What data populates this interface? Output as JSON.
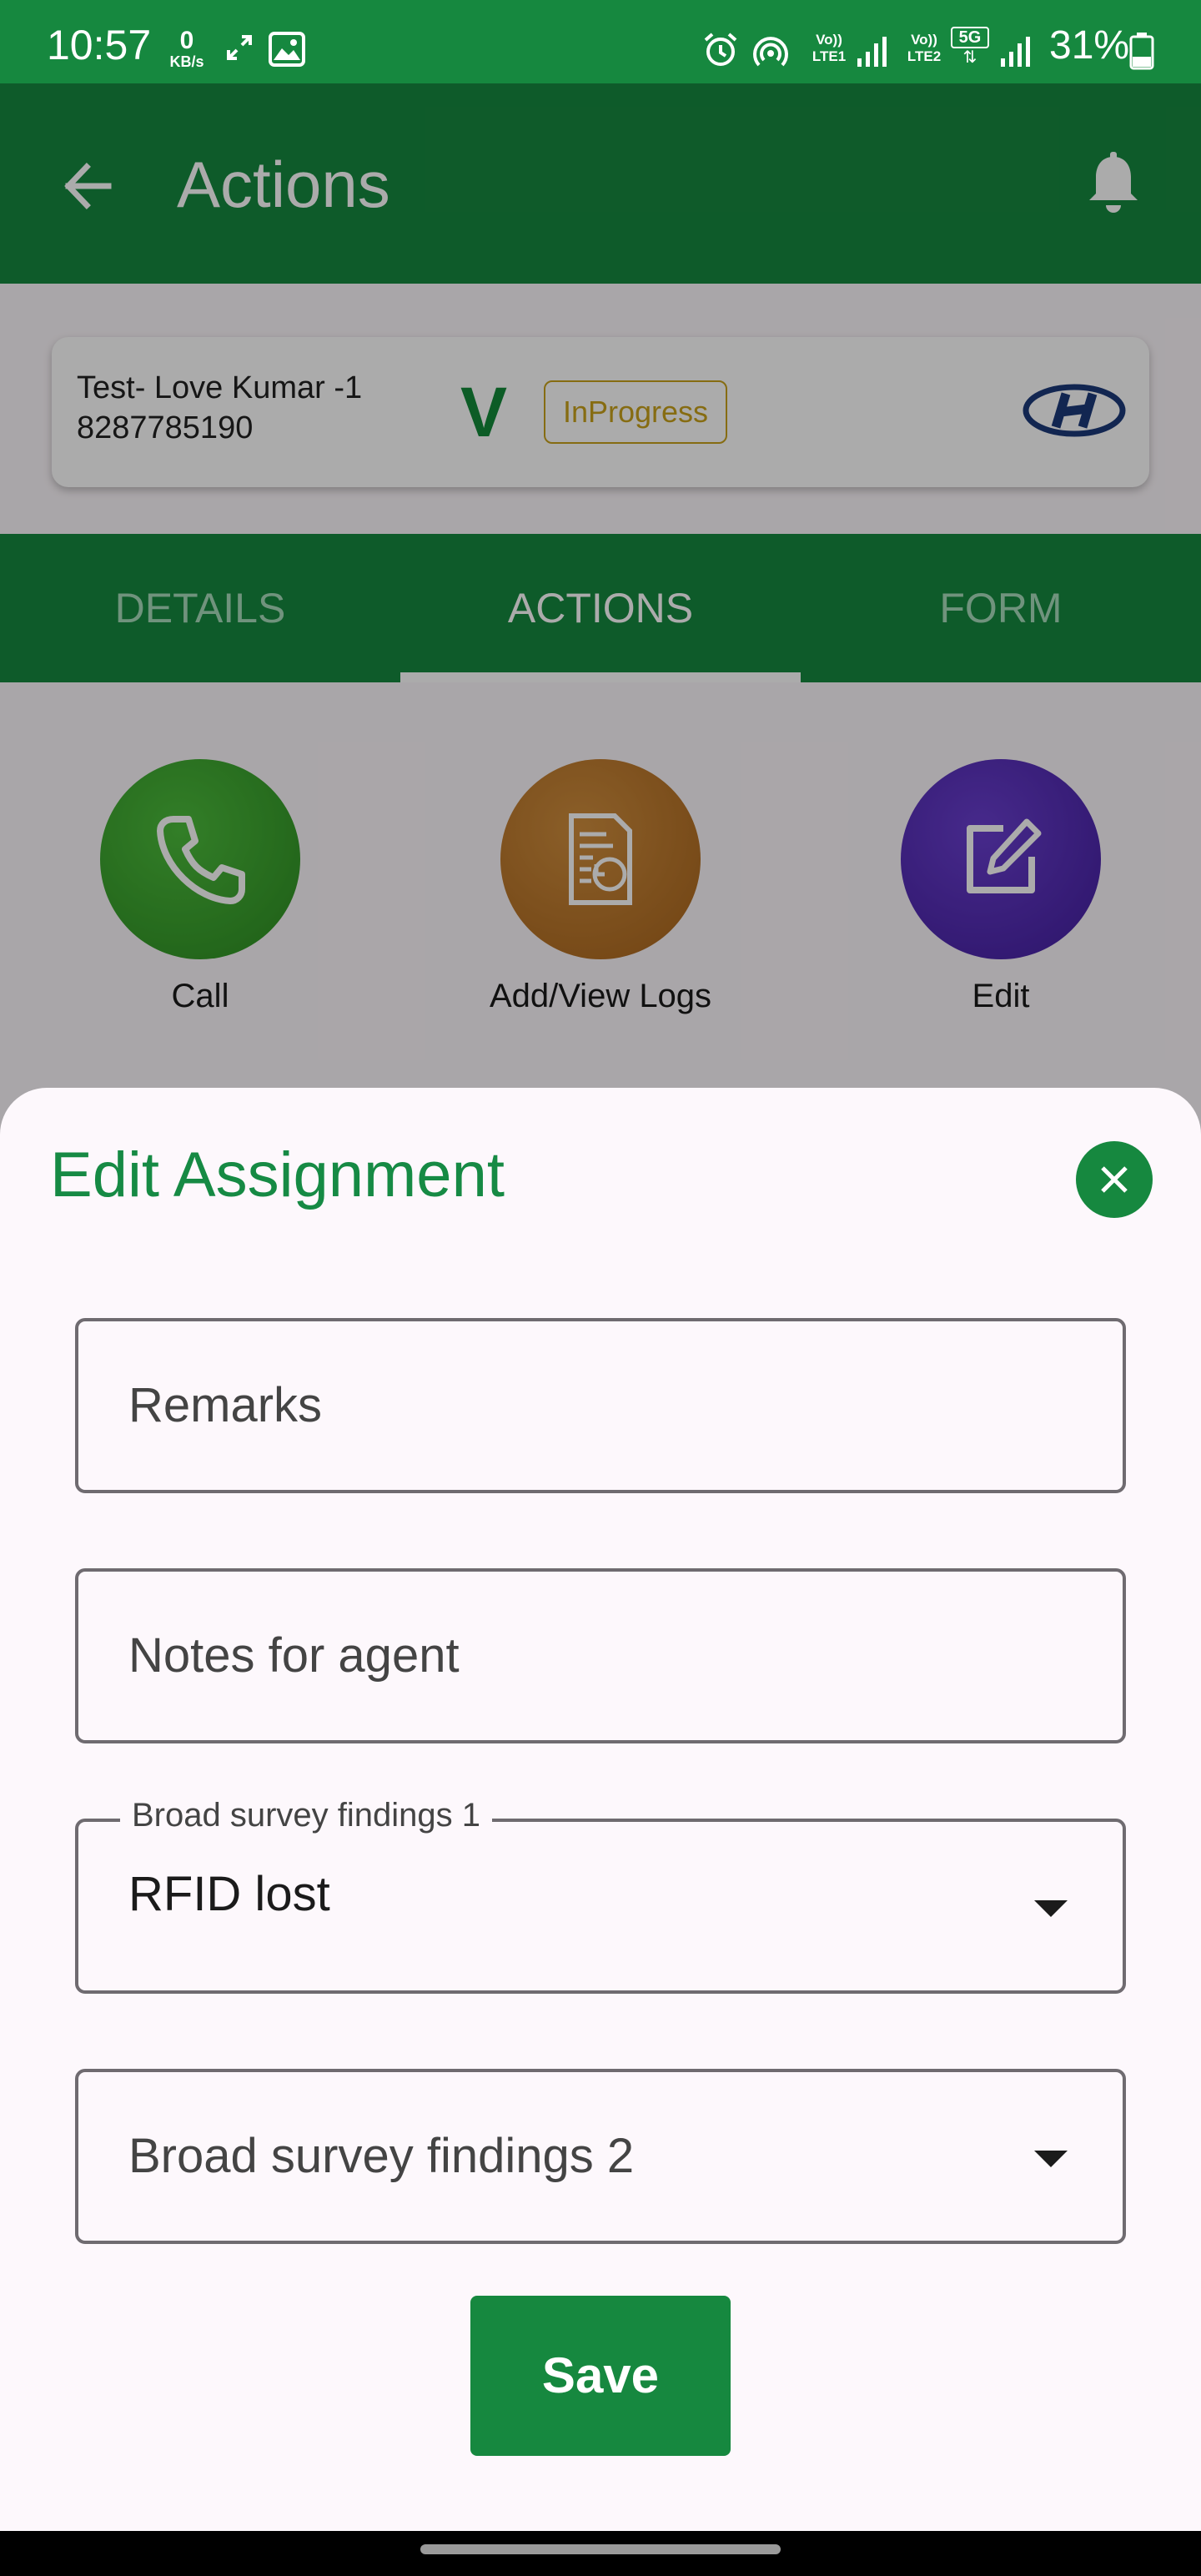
{
  "status_bar": {
    "time": "10:57",
    "net_speed_value": "0",
    "net_speed_unit": "KB/s",
    "battery_percent": "31%",
    "icons": [
      "expand-icon",
      "image-icon",
      "alarm-icon",
      "hotspot-icon",
      "volte-lte1-icon",
      "signal-icon",
      "volte-lte2-icon",
      "5g-icon",
      "signal-icon",
      "battery-icon"
    ],
    "sim1_label_top": "Vo))",
    "sim1_label_bottom": "LTE1",
    "sim2_label_top": "Vo))",
    "sim2_label_bottom": "LTE2",
    "network_5g": "5G"
  },
  "app_bar": {
    "title": "Actions",
    "back_icon": "arrow-left-icon",
    "notification_icon": "bell-icon"
  },
  "assignment": {
    "customer_name": "Test- Love Kumar -1",
    "phone": "8287785190",
    "verified_mark": "V",
    "status": "InProgress",
    "brand_logo": "hyundai-logo"
  },
  "tabs": [
    {
      "label": "DETAILS",
      "active": false
    },
    {
      "label": "ACTIONS",
      "active": true
    },
    {
      "label": "FORM",
      "active": false
    }
  ],
  "actions": [
    {
      "label": "Call",
      "icon": "phone-icon",
      "color": "#3ea530"
    },
    {
      "label": "Add/View Logs",
      "icon": "logs-icon",
      "color": "#c17a2a"
    },
    {
      "label": "Edit",
      "icon": "edit-icon",
      "color": "#5b2dba"
    }
  ],
  "sheet": {
    "title": "Edit Assignment",
    "close_icon": "close-icon",
    "fields": {
      "remarks_placeholder": "Remarks",
      "notes_placeholder": "Notes for agent",
      "finding1_label": "Broad survey findings 1",
      "finding1_value": "RFID lost",
      "finding2_placeholder": "Broad survey findings 2"
    },
    "save_label": "Save"
  },
  "colors": {
    "primary": "#16883f",
    "status_chip": "#c8a21b",
    "title_green": "#168a44"
  }
}
